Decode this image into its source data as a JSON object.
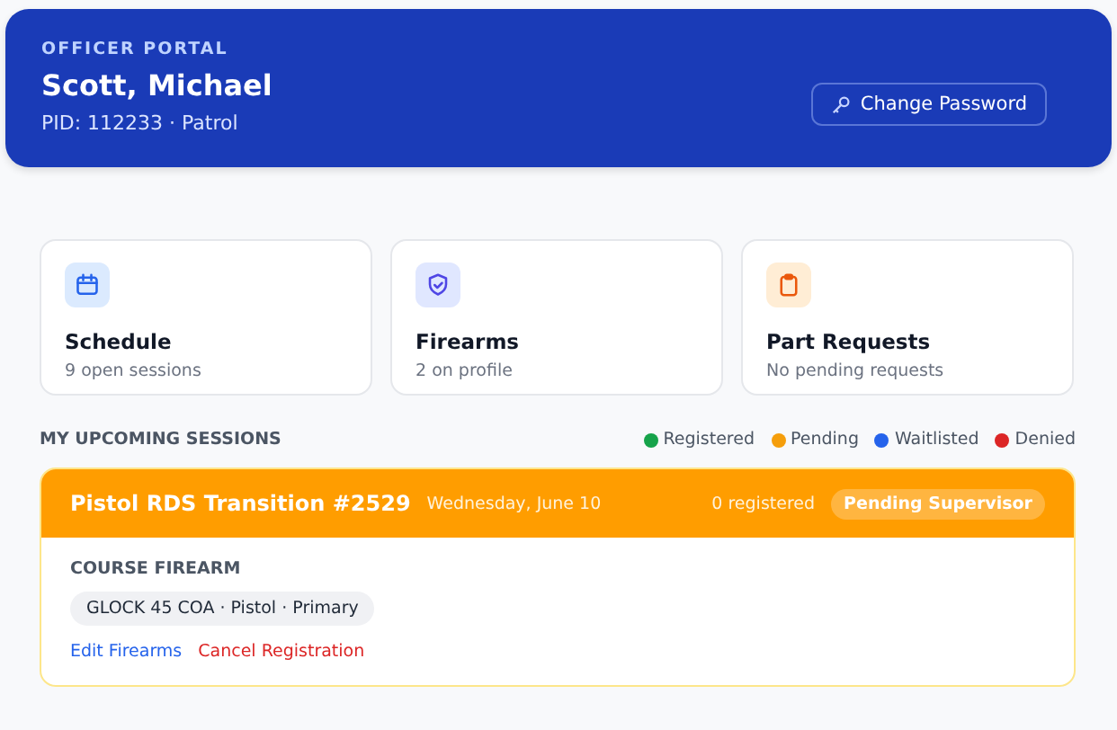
{
  "header": {
    "eyebrow": "OFFICER PORTAL",
    "name": "Scott, Michael",
    "subtitle": "PID: 112233 · Patrol",
    "button": "Change Password"
  },
  "cards": [
    {
      "kind": "calendar",
      "title": "Schedule",
      "subtitle": "9 open sessions"
    },
    {
      "kind": "shield",
      "title": "Firearms",
      "subtitle": "2 on profile"
    },
    {
      "kind": "clipboard",
      "title": "Part Requests",
      "subtitle": "No pending requests"
    }
  ],
  "sessions_section": {
    "title": "MY UPCOMING SESSIONS",
    "legend": [
      {
        "label": "Registered",
        "color": "#16a34a"
      },
      {
        "label": "Pending",
        "color": "#f59e0b"
      },
      {
        "label": "Waitlisted",
        "color": "#2563eb"
      },
      {
        "label": "Denied",
        "color": "#dc2626"
      }
    ]
  },
  "sessions": [
    {
      "kind": "pending",
      "title": "Pistol RDS Transition #2529",
      "date": "Wednesday, June 10",
      "registered": "0 registered",
      "badge": "Pending Supervisor",
      "firearm_label": "COURSE FIREARM",
      "firearm": "GLOCK 45 COA · Pistol · Primary",
      "links": [
        {
          "kind": "edit",
          "label": "Edit Firearms"
        },
        {
          "kind": "cancel",
          "label": "Cancel Registration"
        }
      ]
    }
  ]
}
